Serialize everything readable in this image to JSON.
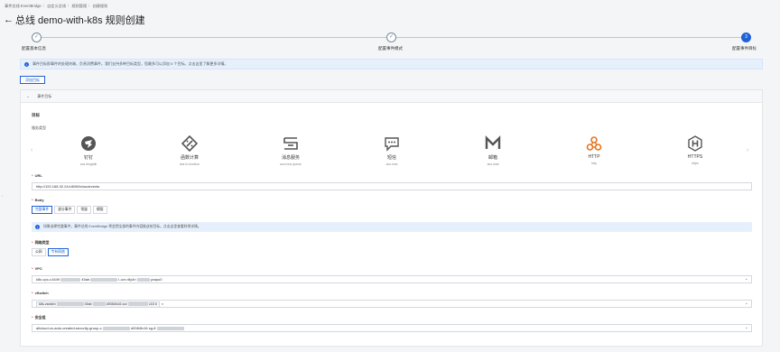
{
  "breadcrumb": [
    "事件总线 EventBridge",
    "自定义总线",
    "规则管理",
    "创建规则"
  ],
  "page_title": "总线 demo-with-k8s 规则创建",
  "steps": [
    {
      "label": "配置基本信息",
      "state": "done"
    },
    {
      "label": "配置事件模式",
      "state": "done"
    },
    {
      "label": "配置事件目标",
      "state": "active",
      "number": "3"
    }
  ],
  "info_bar": "事件目标即事件的处理终端，负责消费事件。我们支持多种目标类型，您最多可以添加 5 个目标。点击这里了解更多详情。",
  "add_target_label": "添加目标",
  "panel": {
    "header": "事件目标",
    "target_title": "目标",
    "service_type_label": "服务类型",
    "services": [
      {
        "name": "钉钉",
        "code": "acs.dingtalk",
        "icon": "dingtalk-icon"
      },
      {
        "name": "函数计算",
        "code": "acs.fc.function",
        "icon": "function-compute-icon"
      },
      {
        "name": "消息服务",
        "code": "acs.mns.queue",
        "icon": "message-service-icon"
      },
      {
        "name": "短信",
        "code": "acs.sms",
        "icon": "sms-icon"
      },
      {
        "name": "邮箱",
        "code": "acs.mail",
        "icon": "mail-icon"
      },
      {
        "name": "HTTP",
        "code": "http",
        "icon": "http-icon"
      },
      {
        "name": "HTTPS",
        "code": "https",
        "icon": "https-icon"
      }
    ],
    "url_label": "URL",
    "url_value": "http://192.168.32.244:8080/cloudevents",
    "body_label": "Body",
    "body_options": [
      "完整事件",
      "部分事件",
      "常量",
      "模版"
    ],
    "body_selected": "完整事件",
    "body_notice": "如果选择完整事件，事件总线 EventBridge 将会把全部的事件内容推送给目标。点击这里查看样例详情。",
    "network_label": "网络类型",
    "network_options": [
      "公网",
      "专有网络"
    ],
    "network_selected": "专有网络",
    "vpc_label": "VPC",
    "vpc_prefix": "k8s-vpc-c1649",
    "vpc_mid": "45ab",
    "vpc_mid2": "i-uvr-r8y4n",
    "vpc_suffix": "yzayu0",
    "vswitch_label": "vSwitch",
    "vswitch_prefix": "k8s-vswitch",
    "vswitch_mid": "45ab",
    "vswitch_mid2": "d0084fc16",
    "vswitch_mid3": "cuv",
    "vswitch_suffix": "c16 b",
    "security_label": "安全组",
    "security_prefix": "alicloud-cs-auto-created-security-group-c",
    "security_suffix": "d0084fc16 sg-8"
  },
  "colors": {
    "accent": "#1f62d6",
    "info_bg": "#e6f0fc",
    "http_orange": "#e8741d"
  }
}
